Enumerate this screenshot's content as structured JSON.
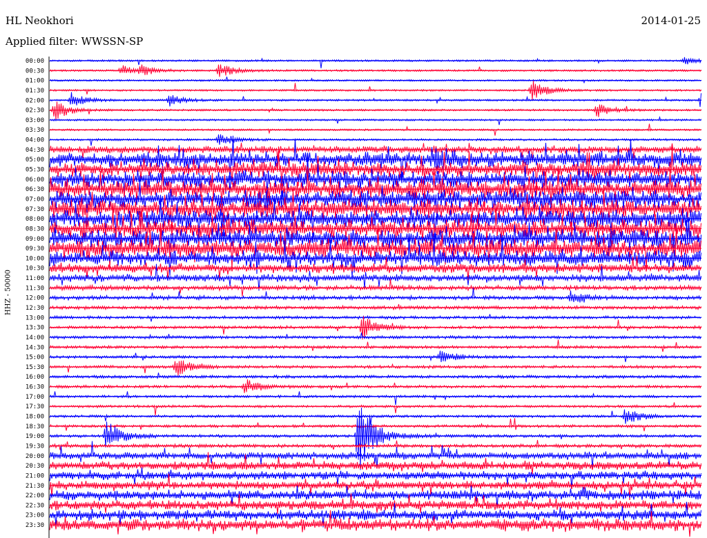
{
  "header": {
    "station": "HL Neokhori",
    "date": "2014-01-25",
    "filter": "Applied filter: WWSSN-SP"
  },
  "channel_label": "HHZ - 50000",
  "colors": {
    "blue": "#0000ff",
    "red": "#ff0033",
    "background": "#ffffff"
  },
  "chart_data": {
    "type": "line",
    "title": "",
    "xlabel": "",
    "ylabel": "HHZ - 50000",
    "grid": false,
    "legend": "none",
    "x_unit": "minute within the half-hour row",
    "xlim": [
      0,
      30
    ],
    "row_labels": [
      "00:00",
      "00:30",
      "01:00",
      "01:30",
      "02:00",
      "02:30",
      "03:00",
      "03:30",
      "04:00",
      "04:30",
      "05:00",
      "05:30",
      "06:00",
      "06:30",
      "07:00",
      "07:30",
      "08:00",
      "08:30",
      "09:00",
      "09:30",
      "10:00",
      "10:30",
      "11:00",
      "11:30",
      "12:00",
      "12:30",
      "13:00",
      "13:30",
      "14:00",
      "14:30",
      "15:00",
      "15:30",
      "16:00",
      "16:30",
      "17:00",
      "17:30",
      "18:00",
      "18:30",
      "19:00",
      "19:30",
      "20:00",
      "20:30",
      "21:00",
      "21:30",
      "22:00",
      "22:30",
      "23:00",
      "23:30"
    ],
    "row_colors": [
      "blue",
      "red"
    ],
    "activity_level": [
      0.12,
      0.14,
      0.1,
      0.1,
      0.12,
      0.14,
      0.1,
      0.1,
      0.18,
      0.6,
      0.9,
      0.9,
      0.95,
      1.0,
      1.0,
      1.0,
      1.0,
      1.0,
      1.0,
      1.0,
      0.9,
      0.7,
      0.6,
      0.45,
      0.4,
      0.35,
      0.3,
      0.3,
      0.3,
      0.28,
      0.28,
      0.28,
      0.3,
      0.28,
      0.25,
      0.25,
      0.25,
      0.28,
      0.3,
      0.35,
      0.6,
      0.65,
      0.65,
      0.68,
      0.7,
      0.72,
      0.75,
      0.8
    ],
    "events": [
      {
        "row": "00:00",
        "minute": 29.2,
        "amplitude": 0.4
      },
      {
        "row": "00:30",
        "minute": 3.3,
        "amplitude": 0.5
      },
      {
        "row": "00:30",
        "minute": 4.2,
        "amplitude": 0.45
      },
      {
        "row": "00:30",
        "minute": 7.8,
        "amplitude": 0.7
      },
      {
        "row": "01:30",
        "minute": 22.2,
        "amplitude": 1.2
      },
      {
        "row": "02:00",
        "minute": 1.0,
        "amplitude": 0.8
      },
      {
        "row": "02:00",
        "minute": 5.5,
        "amplitude": 0.6
      },
      {
        "row": "02:00",
        "minute": 30.0,
        "amplitude": 1.3
      },
      {
        "row": "02:30",
        "minute": 0.2,
        "amplitude": 1.1
      },
      {
        "row": "02:30",
        "minute": 25.2,
        "amplitude": 0.7
      },
      {
        "row": "04:00",
        "minute": 7.8,
        "amplitude": 0.7
      },
      {
        "row": "05:00",
        "minute": 17.8,
        "amplitude": 0.9
      },
      {
        "row": "15:30",
        "minute": 5.8,
        "amplitude": 1.0
      },
      {
        "row": "16:30",
        "minute": 9.0,
        "amplitude": 0.8
      },
      {
        "row": "19:00",
        "minute": 14.2,
        "amplitude": 4.5
      },
      {
        "row": "19:00",
        "minute": 2.6,
        "amplitude": 1.8
      },
      {
        "row": "18:00",
        "minute": 26.5,
        "amplitude": 0.9
      },
      {
        "row": "13:30",
        "minute": 14.4,
        "amplitude": 1.2
      },
      {
        "row": "12:00",
        "minute": 24.0,
        "amplitude": 0.8
      },
      {
        "row": "15:00",
        "minute": 18.0,
        "amplitude": 0.7
      }
    ]
  }
}
